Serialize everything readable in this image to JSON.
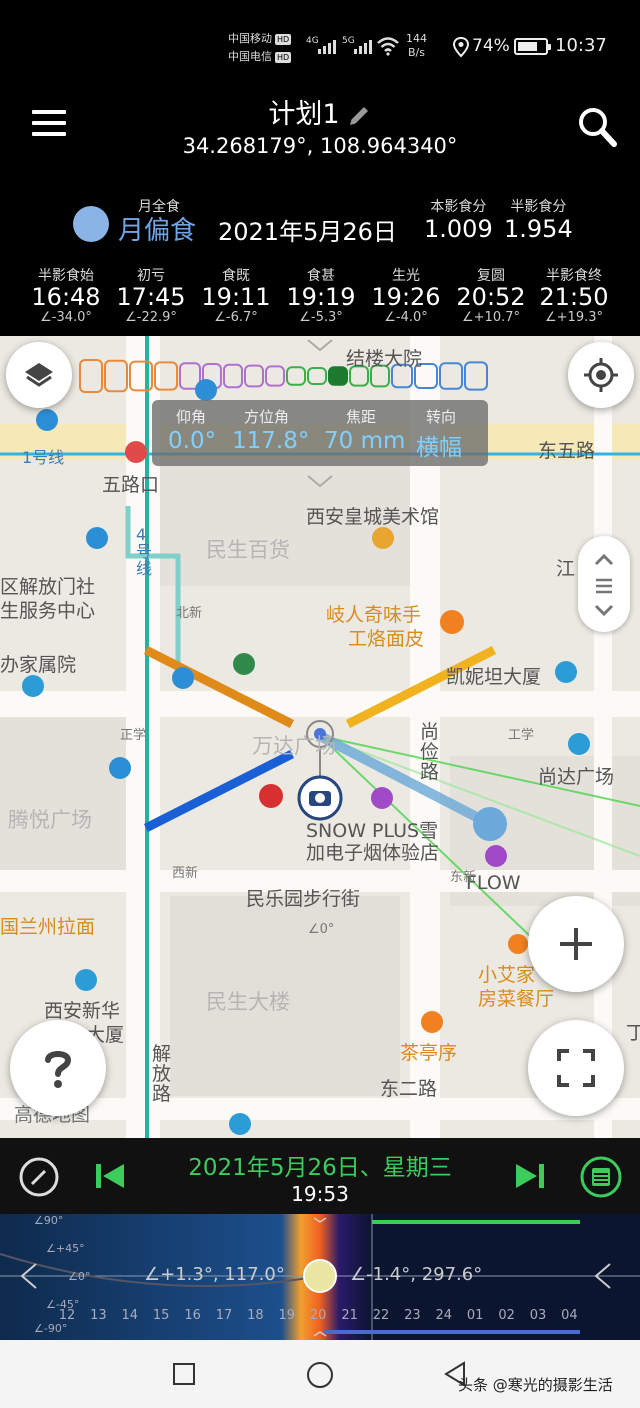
{
  "status_bar": {
    "carrier1": "中国移动",
    "carrier2": "中国电信",
    "hd": "HD",
    "net1": "4G",
    "net2": "5G",
    "speed_value": "144",
    "speed_unit": "B/s",
    "battery": "74%",
    "battery_level": 0.74,
    "time": "10:37"
  },
  "header": {
    "title": "计划1",
    "coords": "34.268179°, 108.964340°"
  },
  "eclipse": {
    "type_small": "月全食",
    "type": "月偏食",
    "date": "2021年5月26日",
    "umbral_label": "本影食分",
    "umbral_value": "1.009",
    "penumbral_label": "半影食分",
    "penumbral_value": "1.954",
    "phases": [
      {
        "label": "半影食始",
        "time": "16:48",
        "alt": "∠-34.0°"
      },
      {
        "label": "初亏",
        "time": "17:45",
        "alt": "∠-22.9°"
      },
      {
        "label": "食既",
        "time": "19:11",
        "alt": "∠-6.7°"
      },
      {
        "label": "食甚",
        "time": "19:19",
        "alt": "∠-5.3°"
      },
      {
        "label": "生光",
        "time": "19:26",
        "alt": "∠-4.0°"
      },
      {
        "label": "复圆",
        "time": "20:52",
        "alt": "∠+10.7°"
      },
      {
        "label": "半影食终",
        "time": "21:50",
        "alt": "∠+19.3°"
      }
    ]
  },
  "camera": {
    "elevation_label": "仰角",
    "elevation": "0.0°",
    "azimuth_label": "方位角",
    "azimuth": "117.8°",
    "focal_label": "焦距",
    "focal": "70 mm",
    "orientation_label": "转向",
    "orientation": "横幅"
  },
  "map_labels": {
    "line1": "1号线",
    "wulukou": "五路口",
    "dongwulu": "东五路",
    "jielou": "结楼大院",
    "xianhuangcheng": "西安皇城美术馆",
    "minsheng_baihuo": "民生百货",
    "line4": "4号线",
    "jiefangmen": "区解放门社",
    "service": "生服务中心",
    "banjia": "办家属院",
    "qirenqi": "岐人奇味手",
    "gonglao": "工烙面皮",
    "kaini": "凯妮坦大厦",
    "wanda": "万达广场",
    "shangjian": "尚俭路",
    "shangda": "尚达广场",
    "tengyue": "腾悦广场",
    "snow1": "SNOW PLUS雪",
    "snow2": "加电子烟体验店",
    "flow": "FLOW",
    "minleyuan": "民乐园步行街",
    "lanzhou": "国兰州拉面",
    "xiaoai1": "小艾家",
    "xiaoai2": "房菜餐厅",
    "minsheng_dalou": "民生大楼",
    "xianxinhua1": "西安新华",
    "xianxinhua2": "大厦",
    "jiefanglu": "解放路",
    "chating": "茶亭序",
    "dongerlu": "东二路",
    "amap": "高德地图",
    "beixin": "北新",
    "xixin": "西新",
    "dongxin": "东新",
    "zhengxue": "正学",
    "gongyu": "工学",
    "jiangxi": "江",
    "ding": "丁",
    "angle0": "∠0°"
  },
  "date_bar": {
    "date": "2021年5月26日、星期三",
    "time": "19:53"
  },
  "timeline": {
    "hours": [
      "12",
      "13",
      "14",
      "15",
      "16",
      "17",
      "18",
      "19",
      "20",
      "21",
      "22",
      "23",
      "24",
      "01",
      "02",
      "03",
      "04"
    ],
    "moon_reading": "∠+1.3°, 117.0°",
    "sun_reading": "∠-1.4°, 297.6°",
    "alt_marks": [
      "∠90°",
      "∠+45°",
      "∠0°",
      "∠-45°",
      "∠-90°"
    ]
  },
  "watermark": "头条 @寒光的摄影生活",
  "colors": {
    "green": "#3ccc5c",
    "moon_blue": "#8ab3e6",
    "info_value": "#7fd0ff",
    "orange_line": "#e08a1a",
    "yellow_line": "#f0b21e",
    "blue_line": "#1b5fd6"
  }
}
